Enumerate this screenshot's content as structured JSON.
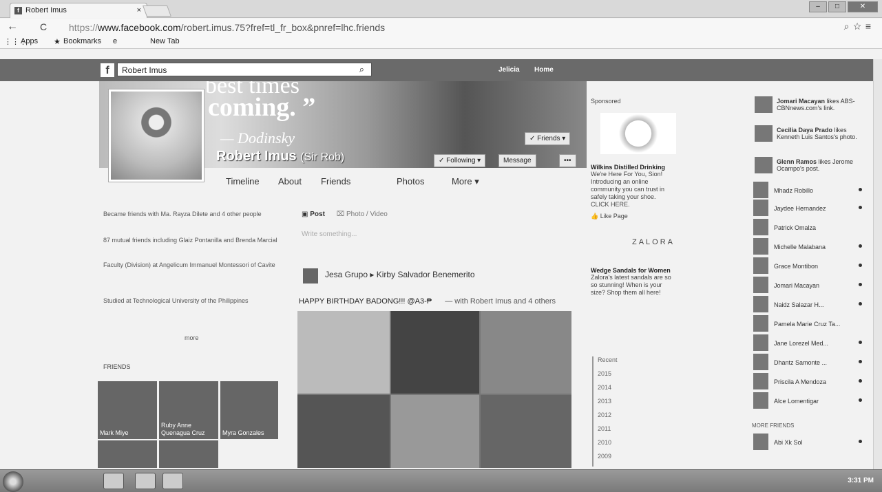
{
  "browser": {
    "tab_title": "Robert Imus",
    "tab_close": "×",
    "url_domain": "www.facebook.com",
    "url_path": "/robert.imus.75?fref=tl_fr_box&pnref=lhc.friends",
    "bookmarks": [
      {
        "label": "Apps"
      },
      {
        "label": "Bookmarks"
      },
      {
        "label": "e"
      },
      {
        "label": "New Tab"
      }
    ]
  },
  "fb": {
    "search_value": "Robert Imus",
    "nav_user": "Jelicia",
    "nav_home": "Home",
    "cover_quote_line1": "best times",
    "cover_quote_line2": "coming. ”",
    "cover_author": "— Dodinsky",
    "profile_name": "Robert Imus",
    "profile_nickname": "(Sir Rob)",
    "friends_button": "✓ Friends ▾",
    "following_button": "✓ Following ▾",
    "message_button": "Message",
    "more_button": "•••",
    "tabs": [
      "Timeline",
      "About",
      "Friends",
      "Photos",
      "More ▾"
    ],
    "intro": [
      "Became friends with Ma. Rayza Dilete and 4 other people",
      "87 mutual friends including Glaiz Pontanilla and Brenda Marcial",
      "Faculty (Division) at Angelicum Immanuel Montessori of Cavite",
      "Studied at Technological University of the Philippines"
    ],
    "intro_more": "more",
    "friends_label": "FRIENDS",
    "friends": [
      {
        "name": "Mark Miye"
      },
      {
        "name": "Ruby Anne Quenagua Cruz"
      },
      {
        "name": "Myra Gonzales"
      }
    ],
    "composer_post": "Post",
    "composer_photo": "Photo / Video",
    "composer_placeholder": "Write something...",
    "post_author": "Jesa Grupo",
    "post_with": "Kirby Salvador Benemerito",
    "post_text": "HAPPY BIRTHDAY BADONG!!! @A3-₱",
    "post_tagged": "— with Robert Imus and 4 others"
  },
  "ads": {
    "sponsored_label": "Sponsored",
    "ad1_title": "Wilkins Distilled Drinking",
    "ad1_body": "We're Here For You, Sion! Introducing an online community you can trust in safely taking your shoe. CLICK HERE.",
    "ad1_like": "Like Page",
    "ad2_brand": "ZALORA",
    "ad2_title": "Wedge Sandals for Women",
    "ad2_body": "Zalora's latest sandals are so so stunning! When is your size? Shop them all here!",
    "recent_label": "Recent",
    "years": [
      "2015",
      "2014",
      "2013",
      "2012",
      "2011",
      "2010",
      "2009"
    ]
  },
  "ticker": [
    {
      "name": "Jomari Macayan",
      "text": "likes ABS-CBNnews.com's link."
    },
    {
      "name": "Cecilia Daya Prado",
      "text": "likes Kenneth Luis Santos's photo."
    },
    {
      "name": "Glenn Ramos",
      "text": "likes Jerome Ocampo's post."
    }
  ],
  "chat": [
    {
      "name": "Mhadz Robillo"
    },
    {
      "name": "Jaydee Hernandez"
    },
    {
      "name": "Patrick Omalza"
    },
    {
      "name": "Michelle Malabana"
    },
    {
      "name": "Grace Montibon"
    },
    {
      "name": "Jomari Macayan"
    },
    {
      "name": "Naidz Salazar H..."
    },
    {
      "name": "Pamela Marie Cruz Ta..."
    },
    {
      "name": "Jane Lorezel Med..."
    },
    {
      "name": "Dhantz Samonte ..."
    },
    {
      "name": "Priscila A Mendoza"
    },
    {
      "name": "Alce Lomentigar"
    },
    {
      "name": "Abi Xk Sol"
    }
  ],
  "chat_more_label": "MORE FRIENDS",
  "taskbar": {
    "clock": "3:31 PM"
  }
}
